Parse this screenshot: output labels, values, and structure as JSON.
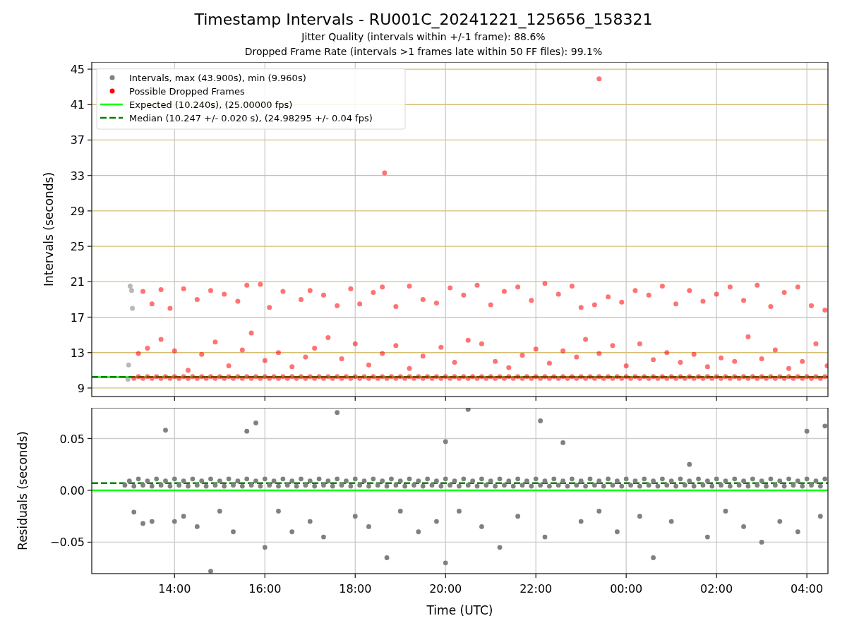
{
  "figure": {
    "title": "Timestamp Intervals - RU001C_20241221_125656_158321",
    "subtitles": [
      "Jitter Quality (intervals within +/-1 frame): 88.6%",
      "Dropped Frame Rate (intervals >1 frames late within 50 FF files): 99.1%"
    ]
  },
  "charts": [
    {
      "chart_data": {
        "type": "scatter",
        "ylabel": "Intervals (seconds)",
        "xlim": [
          "2024-12-21T12:10",
          "2024-12-22T04:28"
        ],
        "ylim": [
          8.04,
          45.8
        ],
        "grid": true,
        "yticks": [
          {
            "value": 9,
            "label": "9"
          },
          {
            "value": 13,
            "label": "13"
          },
          {
            "value": 17,
            "label": "17"
          },
          {
            "value": 21,
            "label": "21"
          },
          {
            "value": 25,
            "label": "25"
          },
          {
            "value": 29,
            "label": "29"
          },
          {
            "value": 33,
            "label": "33"
          },
          {
            "value": 37,
            "label": "37"
          },
          {
            "value": 41,
            "label": "41"
          },
          {
            "value": 45,
            "label": "45"
          }
        ],
        "series": [
          {
            "name": "Intervals, max (43.900s), min (9.960s)",
            "color": "#808080",
            "x": [
              "2024-12-21T12:58",
              "2024-12-21T12:59",
              "2024-12-21T13:01",
              "2024-12-21T13:03",
              "2024-12-21T13:04"
            ],
            "values": [
              10.0,
              11.6,
              20.5,
              20.0,
              18.0
            ]
          },
          {
            "name": "Possible Dropped Frames",
            "color": "#ff0000",
            "x": [
              "2024-12-21T13:06",
              "2024-12-21T13:12",
              "2024-12-21T13:18",
              "2024-12-21T13:24",
              "2024-12-21T13:30",
              "2024-12-21T13:36",
              "2024-12-21T13:42",
              "2024-12-21T13:48",
              "2024-12-21T13:54",
              "2024-12-21T14:00",
              "2024-12-21T14:06",
              "2024-12-21T14:12",
              "2024-12-21T14:18",
              "2024-12-21T14:24",
              "2024-12-21T14:30",
              "2024-12-21T14:36",
              "2024-12-21T14:42",
              "2024-12-21T14:48",
              "2024-12-21T14:54",
              "2024-12-21T15:00",
              "2024-12-21T15:06",
              "2024-12-21T15:12",
              "2024-12-21T15:18",
              "2024-12-21T15:24",
              "2024-12-21T15:30",
              "2024-12-21T15:36",
              "2024-12-21T15:42",
              "2024-12-21T15:48",
              "2024-12-21T15:54",
              "2024-12-21T16:00",
              "2024-12-21T16:06",
              "2024-12-21T16:12",
              "2024-12-21T16:18",
              "2024-12-21T16:24",
              "2024-12-21T16:30",
              "2024-12-21T16:36",
              "2024-12-21T16:42",
              "2024-12-21T16:48",
              "2024-12-21T16:54",
              "2024-12-21T17:00",
              "2024-12-21T17:06",
              "2024-12-21T17:12",
              "2024-12-21T17:18",
              "2024-12-21T17:24",
              "2024-12-21T17:30",
              "2024-12-21T17:36",
              "2024-12-21T17:42",
              "2024-12-21T17:48",
              "2024-12-21T17:54",
              "2024-12-21T18:00",
              "2024-12-21T18:06",
              "2024-12-21T18:12",
              "2024-12-21T18:18",
              "2024-12-21T18:24",
              "2024-12-21T18:30",
              "2024-12-21T18:36",
              "2024-12-21T18:42",
              "2024-12-21T18:48",
              "2024-12-21T18:54",
              "2024-12-21T19:00",
              "2024-12-21T19:06",
              "2024-12-21T19:12",
              "2024-12-21T19:18",
              "2024-12-21T19:24",
              "2024-12-21T19:30",
              "2024-12-21T19:36",
              "2024-12-21T19:42",
              "2024-12-21T19:48",
              "2024-12-21T19:54",
              "2024-12-21T20:00",
              "2024-12-21T20:06",
              "2024-12-21T20:12",
              "2024-12-21T20:18",
              "2024-12-21T20:24",
              "2024-12-21T20:30",
              "2024-12-21T20:36",
              "2024-12-21T20:42",
              "2024-12-21T20:48",
              "2024-12-21T20:54",
              "2024-12-21T21:00",
              "2024-12-21T21:06",
              "2024-12-21T21:12",
              "2024-12-21T21:18",
              "2024-12-21T21:24",
              "2024-12-21T21:30",
              "2024-12-21T21:36",
              "2024-12-21T21:42",
              "2024-12-21T21:48",
              "2024-12-21T21:54",
              "2024-12-21T22:00",
              "2024-12-21T22:06",
              "2024-12-21T22:12",
              "2024-12-21T22:18",
              "2024-12-21T22:24",
              "2024-12-21T22:30",
              "2024-12-21T22:36",
              "2024-12-21T22:42",
              "2024-12-21T22:48",
              "2024-12-21T22:54",
              "2024-12-21T23:00",
              "2024-12-21T23:06",
              "2024-12-21T23:12",
              "2024-12-21T23:18",
              "2024-12-21T23:24",
              "2024-12-21T23:30",
              "2024-12-21T23:36",
              "2024-12-21T23:42",
              "2024-12-21T23:48",
              "2024-12-21T23:54",
              "2024-12-22T00:00",
              "2024-12-22T00:06",
              "2024-12-22T00:12",
              "2024-12-22T00:18",
              "2024-12-22T00:24",
              "2024-12-22T00:30",
              "2024-12-22T00:36",
              "2024-12-22T00:42",
              "2024-12-22T00:48",
              "2024-12-22T00:54",
              "2024-12-22T01:00",
              "2024-12-22T01:06",
              "2024-12-22T01:12",
              "2024-12-22T01:18",
              "2024-12-22T01:24",
              "2024-12-22T01:30",
              "2024-12-22T01:36",
              "2024-12-22T01:42",
              "2024-12-22T01:48",
              "2024-12-22T01:54",
              "2024-12-22T02:00",
              "2024-12-22T02:06",
              "2024-12-22T02:12",
              "2024-12-22T02:18",
              "2024-12-22T02:24",
              "2024-12-22T02:30",
              "2024-12-22T02:36",
              "2024-12-22T02:42",
              "2024-12-22T02:48",
              "2024-12-22T02:54",
              "2024-12-22T03:00",
              "2024-12-22T03:06",
              "2024-12-22T03:12",
              "2024-12-22T03:18",
              "2024-12-22T03:24",
              "2024-12-22T03:30",
              "2024-12-22T03:36",
              "2024-12-22T03:42",
              "2024-12-22T03:48",
              "2024-12-22T03:54",
              "2024-12-22T04:00",
              "2024-12-22T04:06",
              "2024-12-22T04:12",
              "2024-12-22T04:18",
              "2024-12-22T04:24",
              "2024-12-21T13:18",
              "2024-12-21T13:30",
              "2024-12-21T13:42",
              "2024-12-21T13:54",
              "2024-12-21T14:12",
              "2024-12-21T14:30",
              "2024-12-21T14:48",
              "2024-12-21T15:06",
              "2024-12-21T15:24",
              "2024-12-21T15:36",
              "2024-12-21T15:54",
              "2024-12-21T16:06",
              "2024-12-21T16:24",
              "2024-12-21T16:48",
              "2024-12-21T17:00",
              "2024-12-21T17:18",
              "2024-12-21T17:36",
              "2024-12-21T17:54",
              "2024-12-21T18:06",
              "2024-12-21T18:24",
              "2024-12-21T18:36",
              "2024-12-21T18:54",
              "2024-12-21T19:12",
              "2024-12-21T19:30",
              "2024-12-21T19:48",
              "2024-12-21T20:06",
              "2024-12-21T20:24",
              "2024-12-21T20:42",
              "2024-12-21T21:00",
              "2024-12-21T21:18",
              "2024-12-21T21:36",
              "2024-12-21T21:54",
              "2024-12-21T22:12",
              "2024-12-21T22:30",
              "2024-12-21T22:48",
              "2024-12-21T23:00",
              "2024-12-21T23:18",
              "2024-12-21T23:36",
              "2024-12-21T23:54",
              "2024-12-22T00:12",
              "2024-12-22T00:30",
              "2024-12-22T00:48",
              "2024-12-22T01:06",
              "2024-12-22T01:24",
              "2024-12-22T01:42",
              "2024-12-22T02:00",
              "2024-12-22T02:18",
              "2024-12-22T02:36",
              "2024-12-22T02:54",
              "2024-12-22T03:12",
              "2024-12-22T03:30",
              "2024-12-22T03:48",
              "2024-12-22T04:06",
              "2024-12-22T04:24",
              "2024-12-21T13:12",
              "2024-12-21T13:24",
              "2024-12-21T13:42",
              "2024-12-21T14:00",
              "2024-12-21T14:18",
              "2024-12-21T14:36",
              "2024-12-21T14:54",
              "2024-12-21T15:12",
              "2024-12-21T15:30",
              "2024-12-21T15:42",
              "2024-12-21T16:00",
              "2024-12-21T16:18",
              "2024-12-21T16:36",
              "2024-12-21T16:54",
              "2024-12-21T17:06",
              "2024-12-21T17:24",
              "2024-12-21T17:42",
              "2024-12-21T18:00",
              "2024-12-21T18:18",
              "2024-12-21T18:36",
              "2024-12-21T18:54",
              "2024-12-21T19:12",
              "2024-12-21T19:30",
              "2024-12-21T19:54",
              "2024-12-21T20:12",
              "2024-12-21T20:30",
              "2024-12-21T20:48",
              "2024-12-21T21:06",
              "2024-12-21T21:24",
              "2024-12-21T21:42",
              "2024-12-21T22:00",
              "2024-12-21T22:18",
              "2024-12-21T22:36",
              "2024-12-21T22:54",
              "2024-12-21T23:06",
              "2024-12-21T23:24",
              "2024-12-21T23:42",
              "2024-12-22T00:00",
              "2024-12-22T00:18",
              "2024-12-22T00:36",
              "2024-12-22T00:54",
              "2024-12-22T01:12",
              "2024-12-22T01:30",
              "2024-12-22T01:48",
              "2024-12-22T02:06",
              "2024-12-22T02:24",
              "2024-12-22T02:42",
              "2024-12-22T03:00",
              "2024-12-22T03:18",
              "2024-12-22T03:36",
              "2024-12-22T03:54",
              "2024-12-22T04:12",
              "2024-12-22T04:27",
              "2024-12-21T18:39",
              "2024-12-21T23:24"
            ],
            "values": [
              10.1,
              10.3,
              10.1,
              10.3,
              10.1,
              10.3,
              10.1,
              10.3,
              10.1,
              10.3,
              10.1,
              10.3,
              10.1,
              10.3,
              10.1,
              10.3,
              10.1,
              10.3,
              10.1,
              10.3,
              10.1,
              10.3,
              10.1,
              10.3,
              10.1,
              10.3,
              10.1,
              10.3,
              10.1,
              10.3,
              10.1,
              10.3,
              10.1,
              10.3,
              10.1,
              10.3,
              10.1,
              10.3,
              10.1,
              10.3,
              10.1,
              10.3,
              10.1,
              10.3,
              10.1,
              10.3,
              10.1,
              10.3,
              10.1,
              10.3,
              10.1,
              10.3,
              10.1,
              10.3,
              10.1,
              10.3,
              10.1,
              10.3,
              10.1,
              10.3,
              10.1,
              10.3,
              10.1,
              10.3,
              10.1,
              10.3,
              10.1,
              10.3,
              10.1,
              10.3,
              10.1,
              10.3,
              10.1,
              10.3,
              10.1,
              10.3,
              10.1,
              10.3,
              10.1,
              10.3,
              10.1,
              10.3,
              10.1,
              10.3,
              10.1,
              10.3,
              10.1,
              10.3,
              10.1,
              10.3,
              10.1,
              10.3,
              10.1,
              10.3,
              10.1,
              10.3,
              10.1,
              10.3,
              10.1,
              10.3,
              10.1,
              10.3,
              10.1,
              10.3,
              10.1,
              10.3,
              10.1,
              10.3,
              10.1,
              10.3,
              10.1,
              10.3,
              10.1,
              10.3,
              10.1,
              10.3,
              10.1,
              10.3,
              10.1,
              10.3,
              10.1,
              10.3,
              10.1,
              10.3,
              10.1,
              10.3,
              10.1,
              10.3,
              10.1,
              10.3,
              10.1,
              10.3,
              10.1,
              10.3,
              10.1,
              10.3,
              10.1,
              10.3,
              10.1,
              10.3,
              10.1,
              10.3,
              10.1,
              10.3,
              10.1,
              10.3,
              10.1,
              10.3,
              10.1,
              10.3,
              10.1,
              10.3,
              10.1,
              10.3,
              19.9,
              18.5,
              20.1,
              18.0,
              20.2,
              19.0,
              20.0,
              19.6,
              18.8,
              20.6,
              20.7,
              18.1,
              19.9,
              19.0,
              20.0,
              19.5,
              18.3,
              20.2,
              18.5,
              19.8,
              20.4,
              18.2,
              20.5,
              19.0,
              18.6,
              20.3,
              19.5,
              20.6,
              18.4,
              19.9,
              20.4,
              18.9,
              20.8,
              19.6,
              20.5,
              18.1,
              18.4,
              19.3,
              18.7,
              20.0,
              19.5,
              20.5,
              18.5,
              20.0,
              18.8,
              19.6,
              20.4,
              18.9,
              20.6,
              18.2,
              19.8,
              20.4,
              18.3,
              17.8,
              12.9,
              13.5,
              14.5,
              13.2,
              11.0,
              12.8,
              14.2,
              11.5,
              13.3,
              15.2,
              12.1,
              13.0,
              11.4,
              12.5,
              13.5,
              14.7,
              12.3,
              14.0,
              11.6,
              12.9,
              13.8,
              11.2,
              12.6,
              13.6,
              11.9,
              14.4,
              14.0,
              12.0,
              11.3,
              12.7,
              13.4,
              11.8,
              13.2,
              12.5,
              14.5,
              12.9,
              13.8,
              11.5,
              14.0,
              12.2,
              13.0,
              11.9,
              12.8,
              11.4,
              12.4,
              12.0,
              14.8,
              12.3,
              13.3,
              11.2,
              12.0,
              14.0,
              11.5,
              33.3,
              43.9
            ]
          }
        ],
        "ref_lines": [
          {
            "axis": "y",
            "value": 10.24,
            "label": "Expected (10.240s), (25.00000 fps)",
            "color": "#00ff00"
          },
          {
            "axis": "y",
            "value": 10.247,
            "label": "Median (10.247 +/- 0.020 s), (24.98295 +/- 0.04 fps)",
            "color": "#008000"
          }
        ],
        "legend": "upper left"
      }
    },
    {
      "chart_data": {
        "type": "scatter",
        "xlabel": "Time (UTC)",
        "ylabel": "Residuals (seconds)",
        "xlim": [
          "2024-12-21T12:10",
          "2024-12-22T04:28"
        ],
        "ylim": [
          -0.0803,
          0.0796
        ],
        "grid": true,
        "xticks": [
          {
            "value": "2024-12-21T14:00",
            "label": "14:00"
          },
          {
            "value": "2024-12-21T16:00",
            "label": "16:00"
          },
          {
            "value": "2024-12-21T18:00",
            "label": "18:00"
          },
          {
            "value": "2024-12-21T20:00",
            "label": "20:00"
          },
          {
            "value": "2024-12-21T22:00",
            "label": "22:00"
          },
          {
            "value": "2024-12-22T00:00",
            "label": "00:00"
          },
          {
            "value": "2024-12-22T02:00",
            "label": "02:00"
          },
          {
            "value": "2024-12-22T04:00",
            "label": "04:00"
          }
        ],
        "yticks": [
          {
            "value": -0.05,
            "label": "−0.05"
          },
          {
            "value": 0,
            "label": "0.00"
          },
          {
            "value": 0.05,
            "label": "0.05"
          }
        ],
        "series": [
          {
            "color": "#808080",
            "x": [
              "2024-12-21T12:54",
              "2024-12-21T13:00",
              "2024-12-21T13:06",
              "2024-12-21T13:12",
              "2024-12-21T13:18",
              "2024-12-21T13:24",
              "2024-12-21T13:30",
              "2024-12-21T13:36",
              "2024-12-21T13:42",
              "2024-12-21T13:48",
              "2024-12-21T13:54",
              "2024-12-21T14:00",
              "2024-12-21T14:06",
              "2024-12-21T14:12",
              "2024-12-21T14:18",
              "2024-12-21T14:24",
              "2024-12-21T14:30",
              "2024-12-21T14:36",
              "2024-12-21T14:42",
              "2024-12-21T14:48",
              "2024-12-21T14:54",
              "2024-12-21T15:00",
              "2024-12-21T15:06",
              "2024-12-21T15:12",
              "2024-12-21T15:18",
              "2024-12-21T15:24",
              "2024-12-21T15:30",
              "2024-12-21T15:36",
              "2024-12-21T15:42",
              "2024-12-21T15:48",
              "2024-12-21T15:54",
              "2024-12-21T16:00",
              "2024-12-21T16:06",
              "2024-12-21T16:12",
              "2024-12-21T16:18",
              "2024-12-21T16:24",
              "2024-12-21T16:30",
              "2024-12-21T16:36",
              "2024-12-21T16:42",
              "2024-12-21T16:48",
              "2024-12-21T16:54",
              "2024-12-21T17:00",
              "2024-12-21T17:06",
              "2024-12-21T17:12",
              "2024-12-21T17:18",
              "2024-12-21T17:24",
              "2024-12-21T17:30",
              "2024-12-21T17:36",
              "2024-12-21T17:42",
              "2024-12-21T17:48",
              "2024-12-21T17:54",
              "2024-12-21T18:00",
              "2024-12-21T18:06",
              "2024-12-21T18:12",
              "2024-12-21T18:18",
              "2024-12-21T18:24",
              "2024-12-21T18:30",
              "2024-12-21T18:36",
              "2024-12-21T18:42",
              "2024-12-21T18:48",
              "2024-12-21T18:54",
              "2024-12-21T19:00",
              "2024-12-21T19:06",
              "2024-12-21T19:12",
              "2024-12-21T19:18",
              "2024-12-21T19:24",
              "2024-12-21T19:30",
              "2024-12-21T19:36",
              "2024-12-21T19:42",
              "2024-12-21T19:48",
              "2024-12-21T19:54",
              "2024-12-21T20:00",
              "2024-12-21T20:06",
              "2024-12-21T20:12",
              "2024-12-21T20:18",
              "2024-12-21T20:24",
              "2024-12-21T20:30",
              "2024-12-21T20:36",
              "2024-12-21T20:42",
              "2024-12-21T20:48",
              "2024-12-21T20:54",
              "2024-12-21T21:00",
              "2024-12-21T21:06",
              "2024-12-21T21:12",
              "2024-12-21T21:18",
              "2024-12-21T21:24",
              "2024-12-21T21:30",
              "2024-12-21T21:36",
              "2024-12-21T21:42",
              "2024-12-21T21:48",
              "2024-12-21T21:54",
              "2024-12-21T22:00",
              "2024-12-21T22:06",
              "2024-12-21T22:12",
              "2024-12-21T22:18",
              "2024-12-21T22:24",
              "2024-12-21T22:30",
              "2024-12-21T22:36",
              "2024-12-21T22:42",
              "2024-12-21T22:48",
              "2024-12-21T22:54",
              "2024-12-21T23:00",
              "2024-12-21T23:06",
              "2024-12-21T23:12",
              "2024-12-21T23:18",
              "2024-12-21T23:24",
              "2024-12-21T23:30",
              "2024-12-21T23:36",
              "2024-12-21T23:42",
              "2024-12-21T23:48",
              "2024-12-21T23:54",
              "2024-12-22T00:00",
              "2024-12-22T00:06",
              "2024-12-22T00:12",
              "2024-12-22T00:18",
              "2024-12-22T00:24",
              "2024-12-22T00:30",
              "2024-12-22T00:36",
              "2024-12-22T00:42",
              "2024-12-22T00:48",
              "2024-12-22T00:54",
              "2024-12-22T01:00",
              "2024-12-22T01:06",
              "2024-12-22T01:12",
              "2024-12-22T01:18",
              "2024-12-22T01:24",
              "2024-12-22T01:30",
              "2024-12-22T01:36",
              "2024-12-22T01:42",
              "2024-12-22T01:48",
              "2024-12-22T01:54",
              "2024-12-22T02:00",
              "2024-12-22T02:06",
              "2024-12-22T02:12",
              "2024-12-22T02:18",
              "2024-12-22T02:24",
              "2024-12-22T02:30",
              "2024-12-22T02:36",
              "2024-12-22T02:42",
              "2024-12-22T02:48",
              "2024-12-22T02:54",
              "2024-12-22T03:00",
              "2024-12-22T03:06",
              "2024-12-22T03:12",
              "2024-12-22T03:18",
              "2024-12-22T03:24",
              "2024-12-22T03:30",
              "2024-12-22T03:36",
              "2024-12-22T03:42",
              "2024-12-22T03:48",
              "2024-12-22T03:54",
              "2024-12-22T04:00",
              "2024-12-22T04:06",
              "2024-12-22T04:12",
              "2024-12-22T04:18",
              "2024-12-22T04:24",
              "2024-12-21T13:06",
              "2024-12-21T13:18",
              "2024-12-21T13:30",
              "2024-12-21T13:48",
              "2024-12-21T14:00",
              "2024-12-21T14:12",
              "2024-12-21T14:30",
              "2024-12-21T14:48",
              "2024-12-21T15:00",
              "2024-12-21T15:18",
              "2024-12-21T15:36",
              "2024-12-21T15:48",
              "2024-12-21T16:00",
              "2024-12-21T16:18",
              "2024-12-21T16:36",
              "2024-12-21T17:00",
              "2024-12-21T17:18",
              "2024-12-21T17:36",
              "2024-12-21T18:00",
              "2024-12-21T18:18",
              "2024-12-21T18:42",
              "2024-12-21T19:00",
              "2024-12-21T19:24",
              "2024-12-21T19:48",
              "2024-12-21T20:00",
              "2024-12-21T20:00",
              "2024-12-21T20:18",
              "2024-12-21T20:30",
              "2024-12-21T20:48",
              "2024-12-21T21:12",
              "2024-12-21T21:36",
              "2024-12-21T22:06",
              "2024-12-21T22:12",
              "2024-12-21T22:36",
              "2024-12-21T23:00",
              "2024-12-21T23:24",
              "2024-12-21T23:48",
              "2024-12-22T00:18",
              "2024-12-22T00:36",
              "2024-12-22T01:00",
              "2024-12-22T01:24",
              "2024-12-22T01:48",
              "2024-12-22T02:12",
              "2024-12-22T02:36",
              "2024-12-22T03:00",
              "2024-12-22T03:24",
              "2024-12-22T03:48",
              "2024-12-22T04:00",
              "2024-12-22T04:18",
              "2024-12-22T04:24"
            ],
            "values": [
              0.005,
              0.009,
              0.004,
              0.011,
              0.005,
              0.009,
              0.004,
              0.011,
              0.005,
              0.009,
              0.004,
              0.011,
              0.005,
              0.009,
              0.004,
              0.011,
              0.005,
              0.009,
              0.004,
              0.011,
              0.005,
              0.009,
              0.004,
              0.011,
              0.005,
              0.009,
              0.004,
              0.011,
              0.005,
              0.009,
              0.004,
              0.011,
              0.005,
              0.009,
              0.004,
              0.011,
              0.005,
              0.009,
              0.004,
              0.011,
              0.005,
              0.009,
              0.004,
              0.011,
              0.005,
              0.009,
              0.004,
              0.011,
              0.005,
              0.009,
              0.004,
              0.011,
              0.005,
              0.009,
              0.004,
              0.011,
              0.005,
              0.009,
              0.004,
              0.011,
              0.005,
              0.009,
              0.004,
              0.011,
              0.005,
              0.009,
              0.004,
              0.011,
              0.005,
              0.009,
              0.004,
              0.011,
              0.005,
              0.009,
              0.004,
              0.011,
              0.005,
              0.009,
              0.004,
              0.011,
              0.005,
              0.009,
              0.004,
              0.011,
              0.005,
              0.009,
              0.004,
              0.011,
              0.005,
              0.009,
              0.004,
              0.011,
              0.005,
              0.009,
              0.004,
              0.011,
              0.005,
              0.009,
              0.004,
              0.011,
              0.005,
              0.009,
              0.004,
              0.011,
              0.005,
              0.009,
              0.004,
              0.011,
              0.005,
              0.009,
              0.004,
              0.011,
              0.005,
              0.009,
              0.004,
              0.011,
              0.005,
              0.009,
              0.004,
              0.011,
              0.005,
              0.009,
              0.004,
              0.011,
              0.005,
              0.009,
              0.004,
              0.011,
              0.005,
              0.009,
              0.004,
              0.011,
              0.005,
              0.009,
              0.004,
              0.011,
              0.005,
              0.009,
              0.004,
              0.011,
              0.005,
              0.009,
              0.004,
              0.011,
              0.005,
              0.009,
              0.004,
              0.011,
              0.005,
              0.009,
              0.004,
              0.011,
              0.005,
              0.009,
              0.004,
              0.011,
              -0.021,
              -0.032,
              -0.03,
              0.058,
              -0.03,
              -0.025,
              -0.035,
              -0.078,
              -0.02,
              -0.04,
              0.057,
              0.065,
              -0.055,
              -0.02,
              -0.04,
              -0.03,
              -0.045,
              0.075,
              -0.025,
              -0.035,
              -0.065,
              -0.02,
              -0.04,
              -0.03,
              0.047,
              -0.07,
              -0.02,
              0.078,
              -0.035,
              -0.055,
              -0.025,
              0.067,
              -0.045,
              0.046,
              -0.03,
              -0.02,
              -0.04,
              -0.025,
              -0.065,
              -0.03,
              0.025,
              -0.045,
              -0.02,
              -0.035,
              -0.05,
              -0.03,
              -0.04,
              0.057,
              -0.025,
              0.062
            ]
          }
        ],
        "ref_lines": [
          {
            "axis": "y",
            "value": 0,
            "color": "#00ff00"
          },
          {
            "axis": "y",
            "value": 0.007,
            "color": "#008000"
          }
        ]
      }
    }
  ]
}
